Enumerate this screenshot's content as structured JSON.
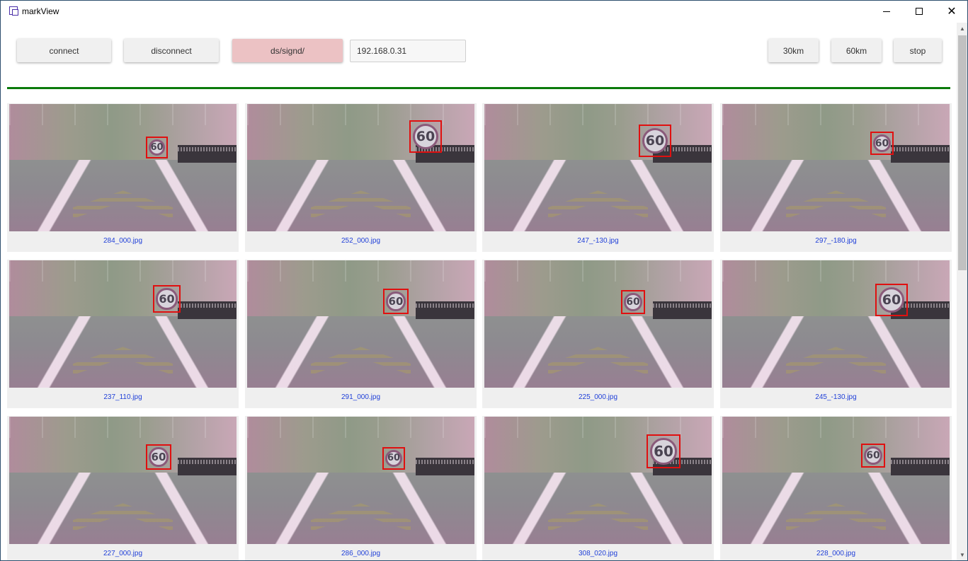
{
  "window": {
    "title": "markView",
    "icon": "app-window-icon",
    "controls": {
      "minimize": "minimize-icon",
      "maximize": "maximize-icon",
      "close": "close-icon"
    }
  },
  "toolbar": {
    "connect_label": "connect",
    "disconnect_label": "disconnect",
    "path_label": "ds/signd/",
    "ip_value": "192.168.0.31",
    "speed30_label": "30km",
    "speed60_label": "60km",
    "stop_label": "stop"
  },
  "colors": {
    "divider": "#0b7a0b",
    "path_button": "#ecc2c4",
    "detection_box": "#e01010",
    "caption_text": "#1f3fd8"
  },
  "gallery": {
    "items": [
      {
        "filename": "284_000.jpg",
        "sign_text": "60"
      },
      {
        "filename": "252_000.jpg",
        "sign_text": "60"
      },
      {
        "filename": "247_-130.jpg",
        "sign_text": "60"
      },
      {
        "filename": "297_-180.jpg",
        "sign_text": "60"
      },
      {
        "filename": "237_110.jpg",
        "sign_text": "60"
      },
      {
        "filename": "291_000.jpg",
        "sign_text": "60"
      },
      {
        "filename": "225_000.jpg",
        "sign_text": "60"
      },
      {
        "filename": "245_-130.jpg",
        "sign_text": "60"
      },
      {
        "filename": "227_000.jpg",
        "sign_text": "60"
      },
      {
        "filename": "286_000.jpg",
        "sign_text": "60"
      },
      {
        "filename": "308_020.jpg",
        "sign_text": "60"
      },
      {
        "filename": "228_000.jpg",
        "sign_text": "60"
      }
    ]
  }
}
